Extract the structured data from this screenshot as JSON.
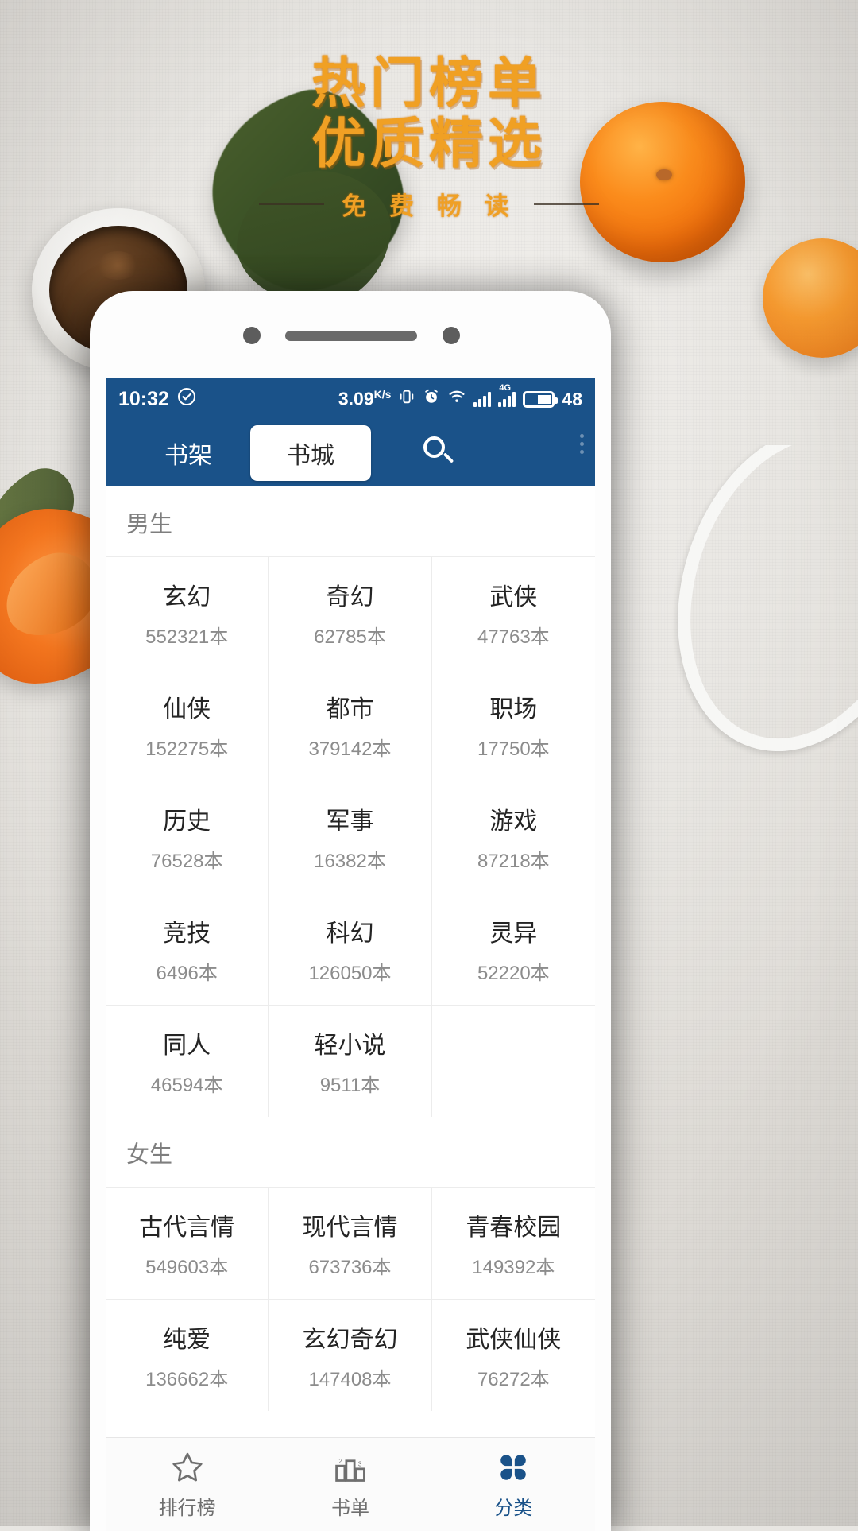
{
  "poster": {
    "title_line1": "热门榜单",
    "title_line2": "优质精选",
    "subtitle": "免 费 畅 读",
    "title_color": "#f0a024",
    "rule_color": "#3b2f22"
  },
  "statusbar": {
    "time": "10:32",
    "check_icon": "check-circle-icon",
    "network_speed": "3.09",
    "network_speed_unit": "K/s",
    "vibrate_icon": "vibrate-icon",
    "alarm_icon": "alarm-clock-icon",
    "wifi_icon": "wifi-icon",
    "signal_icon": "signal-bars-icon",
    "signal_4g_icon": "signal-4g-icon",
    "signal_4g_label": "4G",
    "battery_icon": "battery-icon",
    "battery_level": "48",
    "bg_color": "#1a5289"
  },
  "appbar": {
    "tab_shelf": "书架",
    "tab_store": "书城",
    "search_icon": "search-icon",
    "more_icon": "more-options-icon",
    "active_tab": "书城",
    "bg_color": "#1a5289"
  },
  "sections": [
    {
      "title": "男生",
      "items": [
        {
          "name": "玄幻",
          "count": "552321本"
        },
        {
          "name": "奇幻",
          "count": "62785本"
        },
        {
          "name": "武侠",
          "count": "47763本"
        },
        {
          "name": "仙侠",
          "count": "152275本"
        },
        {
          "name": "都市",
          "count": "379142本"
        },
        {
          "name": "职场",
          "count": "17750本"
        },
        {
          "name": "历史",
          "count": "76528本"
        },
        {
          "name": "军事",
          "count": "16382本"
        },
        {
          "name": "游戏",
          "count": "87218本"
        },
        {
          "name": "竞技",
          "count": "6496本"
        },
        {
          "name": "科幻",
          "count": "126050本"
        },
        {
          "name": "灵异",
          "count": "52220本"
        },
        {
          "name": "同人",
          "count": "46594本"
        },
        {
          "name": "轻小说",
          "count": "9511本"
        },
        {
          "name": "",
          "count": ""
        }
      ]
    },
    {
      "title": "女生",
      "items": [
        {
          "name": "古代言情",
          "count": "549603本"
        },
        {
          "name": "现代言情",
          "count": "673736本"
        },
        {
          "name": "青春校园",
          "count": "149392本"
        },
        {
          "name": "纯爱",
          "count": "136662本"
        },
        {
          "name": "玄幻奇幻",
          "count": "147408本"
        },
        {
          "name": "武侠仙侠",
          "count": "76272本"
        }
      ]
    }
  ],
  "bottomnav": {
    "items": [
      {
        "label": "排行榜",
        "icon": "star-icon",
        "active": false
      },
      {
        "label": "书单",
        "icon": "ranking-bars-icon",
        "active": false
      },
      {
        "label": "分类",
        "icon": "grid-categories-icon",
        "active": true
      }
    ],
    "active_color": "#1a5289",
    "inactive_color": "#6f6f6f"
  }
}
